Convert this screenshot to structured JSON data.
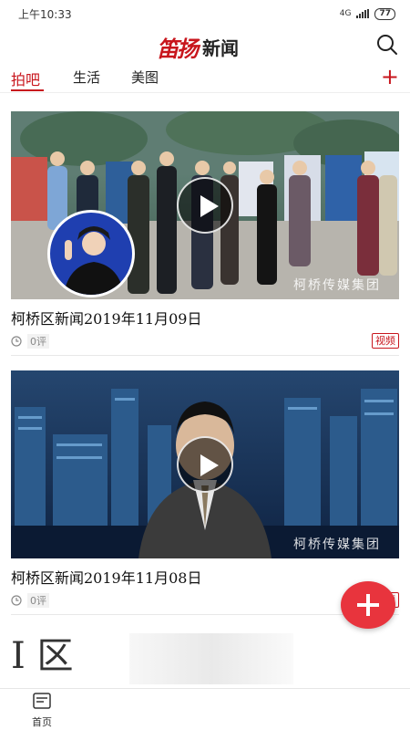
{
  "status": {
    "time": "上午10:33",
    "network": "4G",
    "battery": "77"
  },
  "header": {
    "brand": "笛扬",
    "title": "新闻"
  },
  "tabs": [
    {
      "label": "拍吧",
      "active": true
    },
    {
      "label": "生活",
      "active": false
    },
    {
      "label": "美图",
      "active": false
    }
  ],
  "tabs_add": "+",
  "feed": [
    {
      "title": "柯桥区新闻2019年11月09日",
      "comments": "0评",
      "badge": "视频",
      "watermark": "柯桥传媒集团"
    },
    {
      "title": "柯桥区新闻2019年11月08日",
      "comments": "0评",
      "badge": "视频",
      "watermark": "柯桥传媒集团"
    }
  ],
  "partial_card_text": "I 区",
  "bottom_nav": {
    "home_label": "首页"
  },
  "colors": {
    "accent": "#c8161d",
    "fab": "#e8343d"
  }
}
